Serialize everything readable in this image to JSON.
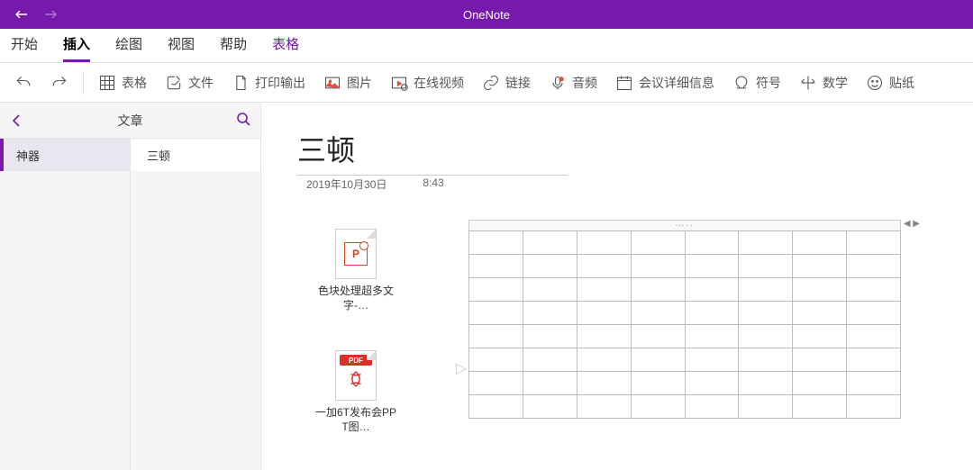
{
  "app": {
    "title": "OneNote"
  },
  "tabs": [
    {
      "label": "开始"
    },
    {
      "label": "插入",
      "active": true
    },
    {
      "label": "绘图"
    },
    {
      "label": "视图"
    },
    {
      "label": "帮助"
    },
    {
      "label": "表格",
      "contextual": true
    }
  ],
  "ribbon": {
    "table": "表格",
    "file": "文件",
    "printout": "打印输出",
    "picture": "图片",
    "onlinevideo": "在线视频",
    "link": "链接",
    "audio": "音频",
    "meeting": "会议详细信息",
    "symbol": "符号",
    "math": "数学",
    "sticker": "贴纸"
  },
  "sidebar": {
    "title": "文章",
    "sections": [
      {
        "label": "神器"
      }
    ],
    "pages": [
      {
        "label": "三顿"
      }
    ]
  },
  "note": {
    "title": "三顿",
    "date": "2019年10月30日",
    "time": "8:43"
  },
  "attachments": [
    {
      "kind": "ppt",
      "label": "色块处理超多文字-…"
    },
    {
      "kind": "pdf",
      "badge": "PDF",
      "label": "一加6T发布会PPT图…"
    }
  ],
  "table": {
    "rows": 8,
    "cols": 8
  }
}
